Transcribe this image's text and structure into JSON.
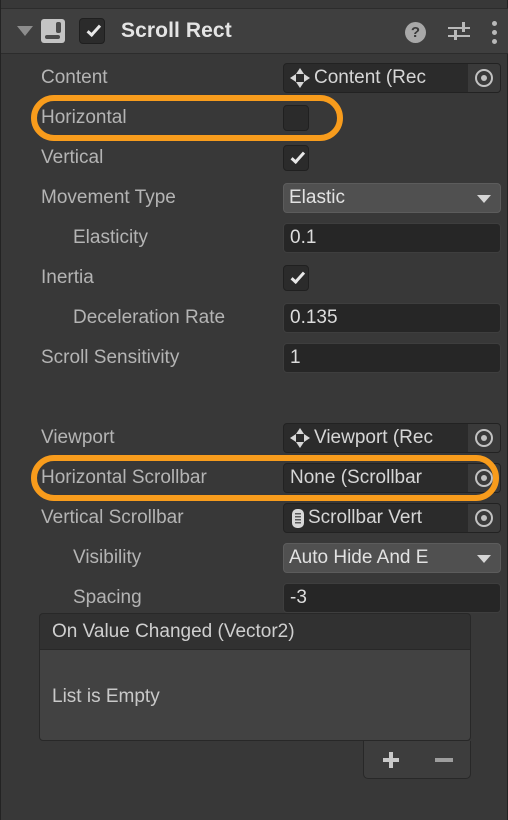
{
  "header": {
    "title": "Scroll Rect",
    "enabled": true,
    "foldout_expanded": true,
    "component_icon": "scroll-rect-icon",
    "help_icon": "help-icon",
    "preset_icon": "preset-settings-icon",
    "menu_icon": "kebab-menu-icon"
  },
  "accent": {
    "highlight": "#f89c1c",
    "panel_bg": "#383838",
    "header_bg": "#3f3f3f",
    "field_bg": "#262626",
    "dropdown_bg": "#505050",
    "object_field_bg": "#2b2b2b"
  },
  "properties": [
    {
      "label": "Content",
      "indent": 0,
      "type": "object",
      "value": "Content (Rec",
      "icon": "rect-transform-icon"
    },
    {
      "label": "Horizontal",
      "indent": 0,
      "type": "checkbox",
      "checked": false,
      "highlighted": true
    },
    {
      "label": "Vertical",
      "indent": 0,
      "type": "checkbox",
      "checked": true
    },
    {
      "label": "Movement Type",
      "indent": 0,
      "type": "dropdown",
      "value": "Elastic"
    },
    {
      "label": "Elasticity",
      "indent": 1,
      "type": "text",
      "value": "0.1"
    },
    {
      "label": "Inertia",
      "indent": 0,
      "type": "checkbox",
      "checked": true
    },
    {
      "label": "Deceleration Rate",
      "indent": 1,
      "type": "text",
      "value": "0.135"
    },
    {
      "label": "Scroll Sensitivity",
      "indent": 0,
      "type": "text",
      "value": "1"
    },
    {
      "label": "",
      "indent": 0,
      "type": "spacer"
    },
    {
      "label": "Viewport",
      "indent": 0,
      "type": "object",
      "value": "Viewport (Rec",
      "icon": "rect-transform-icon"
    },
    {
      "label": "Horizontal Scrollbar",
      "indent": 0,
      "type": "object",
      "value": "None (Scrollbar",
      "icon": "none",
      "highlighted": true
    },
    {
      "label": "Vertical Scrollbar",
      "indent": 0,
      "type": "object",
      "value": "Scrollbar Vert",
      "icon": "scrollbar-icon"
    },
    {
      "label": "Visibility",
      "indent": 1,
      "type": "dropdown",
      "value": "Auto Hide And E"
    },
    {
      "label": "Spacing",
      "indent": 1,
      "type": "text",
      "value": "-3"
    }
  ],
  "event": {
    "title": "On Value Changed (Vector2)",
    "empty_text": "List is Empty",
    "add_label": "+",
    "remove_label": "−"
  }
}
